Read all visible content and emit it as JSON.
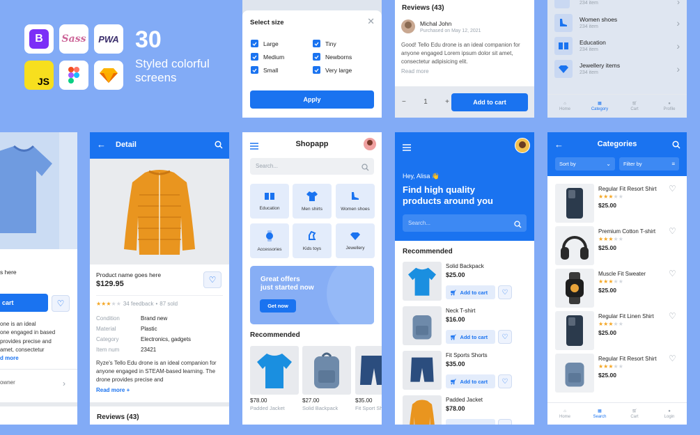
{
  "hero": {
    "count": "30",
    "tagline_line1": "Styled colorful",
    "tagline_line2": "screens",
    "badges": [
      "bootstrap-logo",
      "sass-logo",
      "pwa-logo",
      "javascript-logo",
      "figma-logo",
      "sketch-logo"
    ],
    "badge_labels": {
      "bootstrap": "B",
      "sass": "Sass",
      "pwa": "PWA",
      "js": "JS"
    }
  },
  "colors": {
    "background": "#82abf6",
    "primary": "#1a73f0",
    "star": "#f4a623"
  },
  "size_modal": {
    "title": "Select size",
    "options_left": [
      "Large",
      "Medium",
      "Small"
    ],
    "options_right": [
      "Tiny",
      "Newborns",
      "Very large"
    ],
    "apply": "Apply"
  },
  "reviews_top": {
    "title": "Reviews (43)",
    "reviewer": "Michal John",
    "date": "Purchased on May 12, 2021",
    "text": "Good! Tello Edu drone is an ideal companion for anyone engaged Lorem ipsum dolor sit amet, consectetur adipisicing elit.",
    "read_more": "Read more",
    "qty": "1",
    "minus": "−",
    "plus": "+",
    "add_to_cart": "Add to cart"
  },
  "categories_top": {
    "items": [
      {
        "name": "",
        "sub": "234 item",
        "icon": "shirt-icon"
      },
      {
        "name": "Women shoes",
        "sub": "234 item",
        "icon": "shoe-icon"
      },
      {
        "name": "Education",
        "sub": "234 item",
        "icon": "book-icon"
      },
      {
        "name": "Jewellery items",
        "sub": "234 item",
        "icon": "diamond-icon"
      }
    ],
    "nav": [
      "Home",
      "Category",
      "Cart",
      "Profile"
    ]
  },
  "left_partial": {
    "here_text": "s here",
    "cart_label": "cart",
    "desc_lines": [
      "one is an ideal",
      "one engaged in based",
      "provides precise and",
      "amet, consectetur"
    ],
    "more": "d more",
    "owner": "owner"
  },
  "detail": {
    "title": "Detail",
    "product_name": "Product name goes here",
    "price": "$129.95",
    "feedback": "34 feedback",
    "sold": "87 sold",
    "specs": [
      {
        "label": "Condition",
        "value": "Brand new"
      },
      {
        "label": "Material",
        "value": "Plastic"
      },
      {
        "label": "Category",
        "value": "Electronics, gadgets"
      },
      {
        "label": "Item num",
        "value": "23421"
      }
    ],
    "description": "Ryze's Tello Edu drone is an ideal companion for anyone engaged in STEAM-based learning. The drone provides precise and",
    "read_more": "Read more +",
    "reviews": "Reviews (43)"
  },
  "shopapp": {
    "title": "Shopapp",
    "search_placeholder": "Search...",
    "categories": [
      {
        "label": "Education",
        "icon": "book-icon"
      },
      {
        "label": "Men shirts",
        "icon": "shirt-icon"
      },
      {
        "label": "Women shoes",
        "icon": "shoe-icon"
      },
      {
        "label": "Accessories",
        "icon": "watch-icon"
      },
      {
        "label": "Kids toys",
        "icon": "horse-icon"
      },
      {
        "label": "Jewellery",
        "icon": "diamond-icon"
      }
    ],
    "offer_line1": "Great offers",
    "offer_line2": "just started now",
    "offer_button": "Get now",
    "recommended": "Recommended",
    "products": [
      {
        "price": "$78.00",
        "name": "Padded Jacket"
      },
      {
        "price": "$27.00",
        "name": "Solid Backpack"
      },
      {
        "price": "$35.00",
        "name": "Fit Sport Sh"
      }
    ]
  },
  "home": {
    "greeting": "Hey, Alisa 👋",
    "headline_line1": "Find high quality",
    "headline_line2": "products around you",
    "search_placeholder": "Search...",
    "recommended": "Recommended",
    "items": [
      {
        "name": "Solid Backpack",
        "price": "$25.00"
      },
      {
        "name": "Neck T-shirt",
        "price": "$16.00"
      },
      {
        "name": "Fit Sports Shorts",
        "price": "$35.00"
      },
      {
        "name": "Padded Jacket",
        "price": "$78.00"
      }
    ],
    "add_to_cart": "Add to cart"
  },
  "categories_list": {
    "title": "Categories",
    "sort_by": "Sort by",
    "filter_by": "Filter by",
    "items": [
      {
        "name": "Regular Fit Resort Shirt",
        "price": "$25.00"
      },
      {
        "name": "Premium Cotton T-shirt",
        "price": "$25.00"
      },
      {
        "name": "Muscle Fit Sweater",
        "price": "$25.00"
      },
      {
        "name": "Regular Fit Linen Shirt",
        "price": "$25.00"
      },
      {
        "name": "Regular Fit Resort Shirt",
        "price": "$25.00"
      }
    ],
    "nav": [
      "Home",
      "Search",
      "Cart",
      "Login"
    ]
  }
}
